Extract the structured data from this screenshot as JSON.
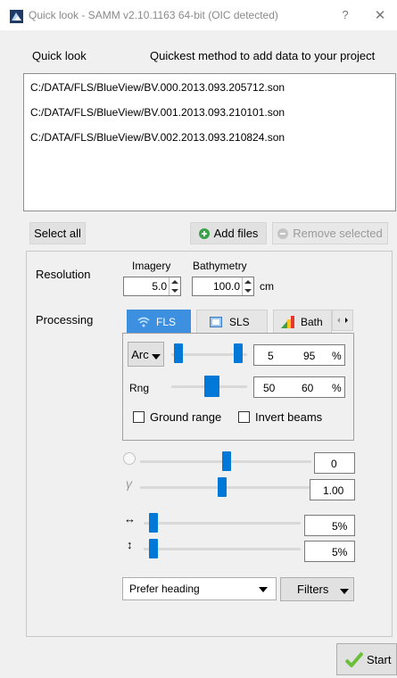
{
  "window": {
    "title": "Quick look - SAMM v2.10.1163 64-bit (OIC detected)",
    "help_glyph": "?",
    "close_glyph": "✕"
  },
  "header": {
    "label": "Quick look",
    "description": "Quickest method to add data to your project"
  },
  "files": [
    "C:/DATA/FLS/BlueView/BV.000.2013.093.205712.son",
    "C:/DATA/FLS/BlueView/BV.001.2013.093.210101.son",
    "C:/DATA/FLS/BlueView/BV.002.2013.093.210824.son"
  ],
  "buttons": {
    "select_all": "Select all",
    "add_files": "Add files",
    "remove_selected": "Remove selected",
    "start": "Start",
    "filters": "Filters"
  },
  "resolution": {
    "label": "Resolution",
    "imagery_label": "Imagery",
    "imagery_value": "5.0",
    "bathymetry_label": "Bathymetry",
    "bathymetry_value": "100.0",
    "unit": "cm"
  },
  "processing": {
    "label": "Processing",
    "tabs": [
      {
        "label": "FLS",
        "active": true
      },
      {
        "label": "SLS",
        "active": false
      },
      {
        "label": "Bath",
        "active": false
      }
    ],
    "arc": {
      "label": "Arc",
      "min": "5",
      "max": "95",
      "unit": "%"
    },
    "rng": {
      "label": "Rng",
      "min": "50",
      "max": "60",
      "unit": "%"
    },
    "ground_range_label": "Ground range",
    "ground_range_checked": false,
    "invert_beams_label": "Invert beams",
    "invert_beams_checked": false
  },
  "adjustments": {
    "brightness_value": "0",
    "gamma_value": "1.00",
    "horizontal_value": "5%",
    "vertical_value": "5%",
    "horizontal_glyph": "↔",
    "vertical_glyph": "↕",
    "gamma_glyph": "γ"
  },
  "heading_select": {
    "selected": "Prefer heading"
  },
  "colors": {
    "accent": "#0078d7",
    "tab_active": "#3d8fe0",
    "add_green": "#3aa14a",
    "start_check": "#6bbf3a"
  }
}
